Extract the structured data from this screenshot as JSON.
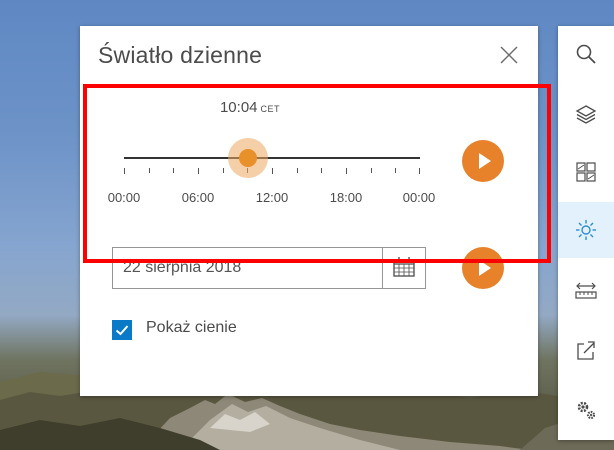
{
  "panel": {
    "title": "Światło dzienne",
    "time": {
      "value": "10:04",
      "timezone": "CET"
    },
    "slider": {
      "position_fraction": 0.42,
      "tick_labels": [
        "00:00",
        "06:00",
        "12:00",
        "18:00",
        "00:00"
      ]
    },
    "date": {
      "value": "22 sierpnia 2018"
    },
    "show_shadows": {
      "label": "Pokaż cienie",
      "checked": true
    }
  },
  "toolbar": {
    "items": [
      {
        "icon": "search-icon"
      },
      {
        "icon": "layers-icon"
      },
      {
        "icon": "basemap-gallery-icon"
      },
      {
        "icon": "daylight-icon",
        "active": true
      },
      {
        "icon": "measure-icon"
      },
      {
        "icon": "share-icon"
      },
      {
        "icon": "settings-icon"
      }
    ]
  },
  "colors": {
    "accent": "#e8822a",
    "checkbox": "#0a7ac8",
    "active_tool": "#e2f1fb",
    "highlight": "#ff0000"
  }
}
